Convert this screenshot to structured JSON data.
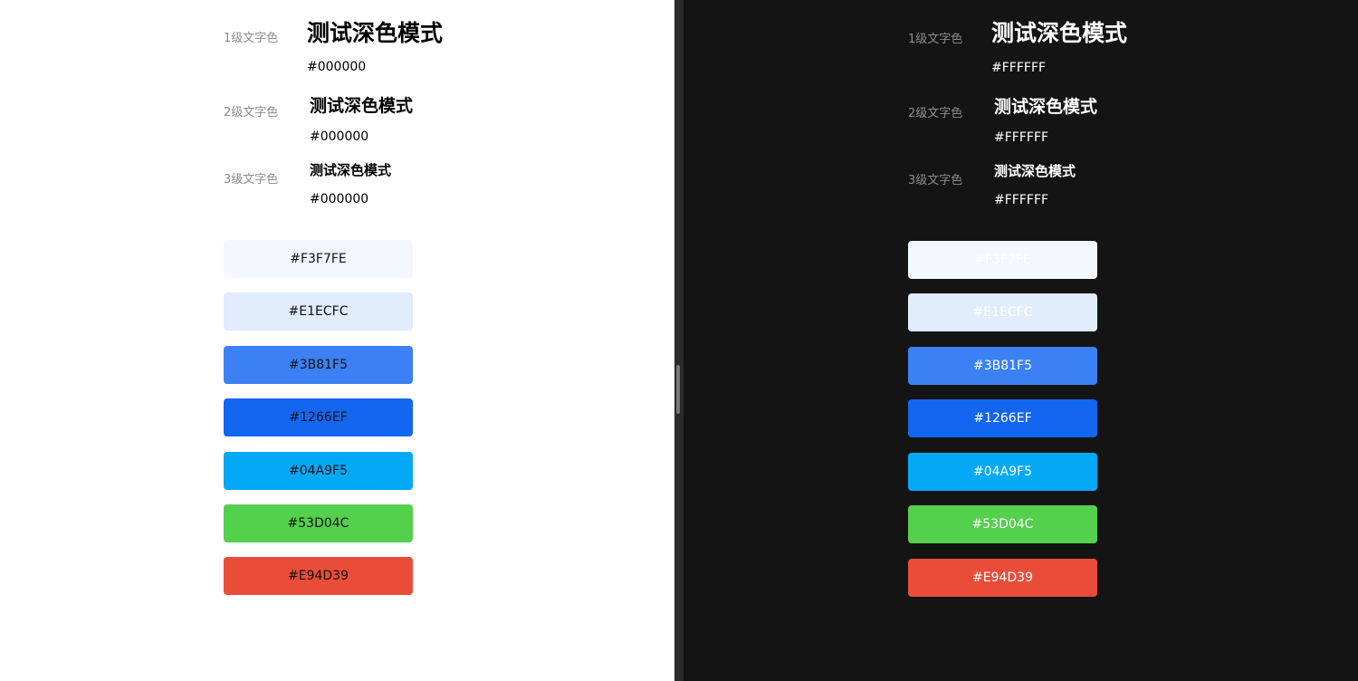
{
  "light": {
    "rows": [
      {
        "label": "1级文字色",
        "heading": "测试深色模式",
        "hex": "#000000"
      },
      {
        "label": "2级文字色",
        "heading": "测试深色模式",
        "hex": "#000000"
      },
      {
        "label": "3级文字色",
        "heading": "测试深色模式",
        "hex": "#000000"
      }
    ],
    "swatches": [
      {
        "label": "#F3F7FE",
        "color": "#F3F7FE"
      },
      {
        "label": "#E1ECFC",
        "color": "#E1ECFC"
      },
      {
        "label": "#3B81F5",
        "color": "#3B81F5"
      },
      {
        "label": "#1266EF",
        "color": "#1266EF"
      },
      {
        "label": "#04A9F5",
        "color": "#04A9F5"
      },
      {
        "label": "#53D04C",
        "color": "#53D04C"
      },
      {
        "label": "#E94D39",
        "color": "#E94D39"
      }
    ]
  },
  "dark": {
    "rows": [
      {
        "label": "1级文字色",
        "heading": "测试深色模式",
        "hex": "#FFFFFF"
      },
      {
        "label": "2级文字色",
        "heading": "测试深色模式",
        "hex": "#FFFFFF"
      },
      {
        "label": "3级文字色",
        "heading": "测试深色模式",
        "hex": "#FFFFFF"
      }
    ],
    "swatches": [
      {
        "label": "#F3F7FE",
        "color": "#F3F7FE"
      },
      {
        "label": "#E1ECFC",
        "color": "#E1ECFC"
      },
      {
        "label": "#3B81F5",
        "color": "#3B81F5"
      },
      {
        "label": "#1266EF",
        "color": "#1266EF"
      },
      {
        "label": "#04A9F5",
        "color": "#04A9F5"
      },
      {
        "label": "#53D04C",
        "color": "#53D04C"
      },
      {
        "label": "#E94D39",
        "color": "#E94D39"
      }
    ]
  }
}
